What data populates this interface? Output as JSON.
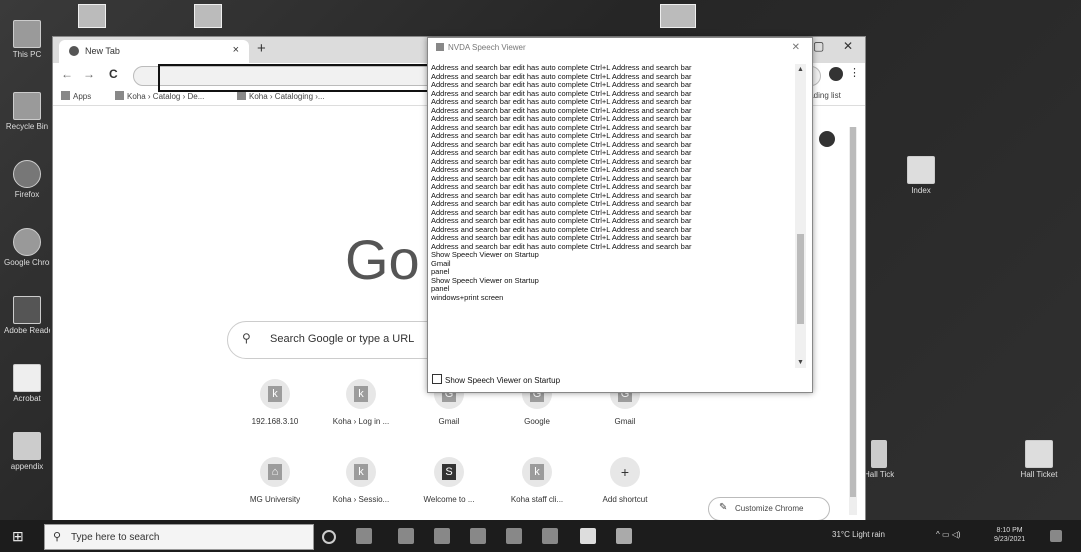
{
  "desktop": {
    "left_icons": [
      "This PC",
      "Recycle Bin",
      "Firefox",
      "Google Chrome",
      "Adobe Reader",
      "Acrobat",
      "appendix"
    ],
    "right_icons": [
      "Index",
      "Hall Ticket",
      "Hall Ticket"
    ]
  },
  "chrome": {
    "tab_title": "New Tab",
    "tab_close": "×",
    "new_tab": "+",
    "win_min": "—",
    "win_max": "▢",
    "win_close": "✕",
    "nav_back": "←",
    "nav_forward": "→",
    "nav_reload": "C",
    "bookmarks": {
      "apps": "Apps",
      "item1": "Koha › Catalog › De...",
      "item2": "Koha › Cataloging ›...",
      "reading_list": "Reading list"
    },
    "google_logo": "Go",
    "search_placeholder": "Search Google or type a URL",
    "shortcuts": [
      {
        "label": "192.168.3.10",
        "glyph": "k"
      },
      {
        "label": "Koha › Log in ...",
        "glyph": "k"
      },
      {
        "label": "Gmail",
        "glyph": "G"
      },
      {
        "label": "Google",
        "glyph": "G"
      },
      {
        "label": "Gmail",
        "glyph": "G"
      },
      {
        "label": "MG University",
        "glyph": "⌂"
      },
      {
        "label": "Koha › Sessio...",
        "glyph": "k"
      },
      {
        "label": "Welcome to ...",
        "glyph": "S"
      },
      {
        "label": "Koha staff cli...",
        "glyph": "k"
      },
      {
        "label": "Add shortcut",
        "glyph": "+"
      }
    ],
    "customize": "Customize Chrome"
  },
  "nvda": {
    "title": "NVDA Speech Viewer",
    "close": "✕",
    "repeat_line": "Address and search bar  edit  has auto complete  Ctrl+L  Address and search bar",
    "tail_lines": [
      "Show Speech Viewer on Startup",
      "Gmail",
      "panel",
      "Show Speech Viewer on Startup",
      "panel",
      "windows+print screen"
    ],
    "checkbox": "Show Speech Viewer on Startup"
  },
  "taskbar": {
    "start": "⊞",
    "search": "Type here to search",
    "weather": "31°C  Light rain",
    "time": "8:10 PM",
    "date": "9/23/2021"
  }
}
